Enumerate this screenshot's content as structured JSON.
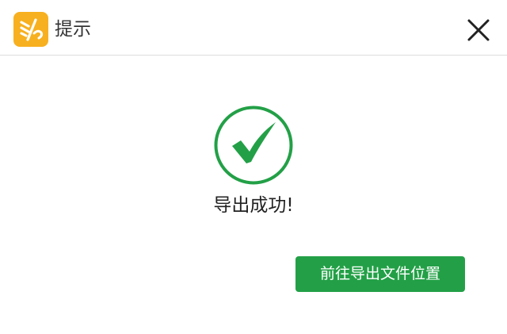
{
  "dialog": {
    "title": "提示",
    "app_icon": "app-logo-icon",
    "close_icon": "close-icon",
    "status_icon": "check-circle-icon",
    "message": "导出成功!",
    "action_label": "前往导出文件位置"
  },
  "colors": {
    "accent": "#23a047",
    "app_icon_bg": "#f7b01f",
    "title_text": "#333333",
    "divider": "#dcdcdc"
  }
}
